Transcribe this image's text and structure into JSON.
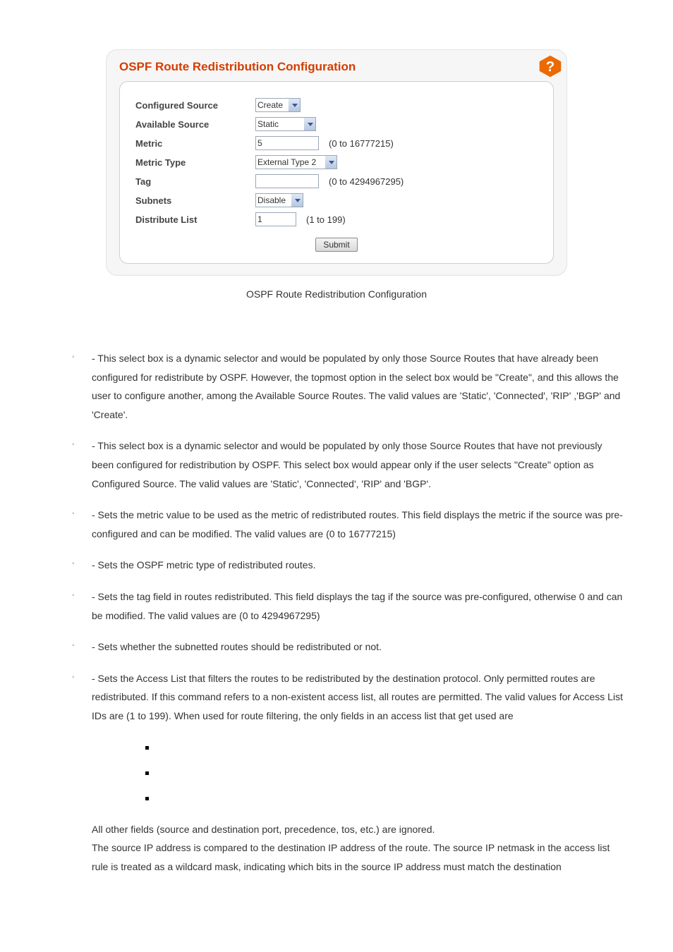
{
  "figure": {
    "title": "OSPF Route Redistribution Configuration",
    "caption": "OSPF Route Redistribution Configuration",
    "fields": {
      "configured_source": {
        "label": "Configured Source",
        "value": "Create"
      },
      "available_source": {
        "label": "Available Source",
        "value": "Static"
      },
      "metric": {
        "label": "Metric",
        "value": "5",
        "hint": "(0 to 16777215)"
      },
      "metric_type": {
        "label": "Metric Type",
        "value": "External Type 2"
      },
      "tag": {
        "label": "Tag",
        "value": "",
        "hint": "(0 to 4294967295)"
      },
      "subnets": {
        "label": "Subnets",
        "value": "Disable"
      },
      "distribute_list": {
        "label": "Distribute List",
        "value": "1",
        "hint": "(1 to 199)"
      }
    },
    "submit": "Submit"
  },
  "doc": {
    "items": [
      " - This select box is a dynamic selector and would be populated by only those Source Routes that have already been configured for redistribute by OSPF. However, the topmost option in the select box would be \"Create\", and this allows the user to configure another, among the Available Source Routes. The valid values are 'Static', 'Connected', 'RIP' ,'BGP' and 'Create'.",
      " - This select box is a dynamic selector and would be populated by only those Source Routes that have not previously been configured for redistribution by OSPF. This select box would appear only if the user selects \"Create\" option as Configured Source. The valid values are 'Static', 'Connected', 'RIP' and 'BGP'.",
      " - Sets the metric value to be used as the metric of redistributed routes. This field displays the metric if the source was pre-configured and can be modified. The valid values are (0 to 16777215)",
      " - Sets the OSPF metric type of redistributed routes.",
      " - Sets the tag field in routes redistributed. This field displays the tag if the source was pre-configured, otherwise 0 and can be modified. The valid values are (0 to 4294967295)",
      " - Sets whether the subnetted routes should be redistributed or not.",
      " - Sets the Access List that filters the routes to be redistributed by the destination protocol. Only permitted routes are redistributed. If this command refers to a non-existent access list, all routes are permitted. The valid values for Access List IDs are (1 to 199). When used for route filtering, the only fields in an access list that get used are"
    ],
    "after1": "All other fields (source and destination port, precedence, tos, etc.) are ignored.",
    "after2": "The source IP address is compared to the destination IP address of the route. The source IP netmask in the access list rule is treated as a wildcard mask, indicating which bits in the source IP address must match the destination"
  }
}
